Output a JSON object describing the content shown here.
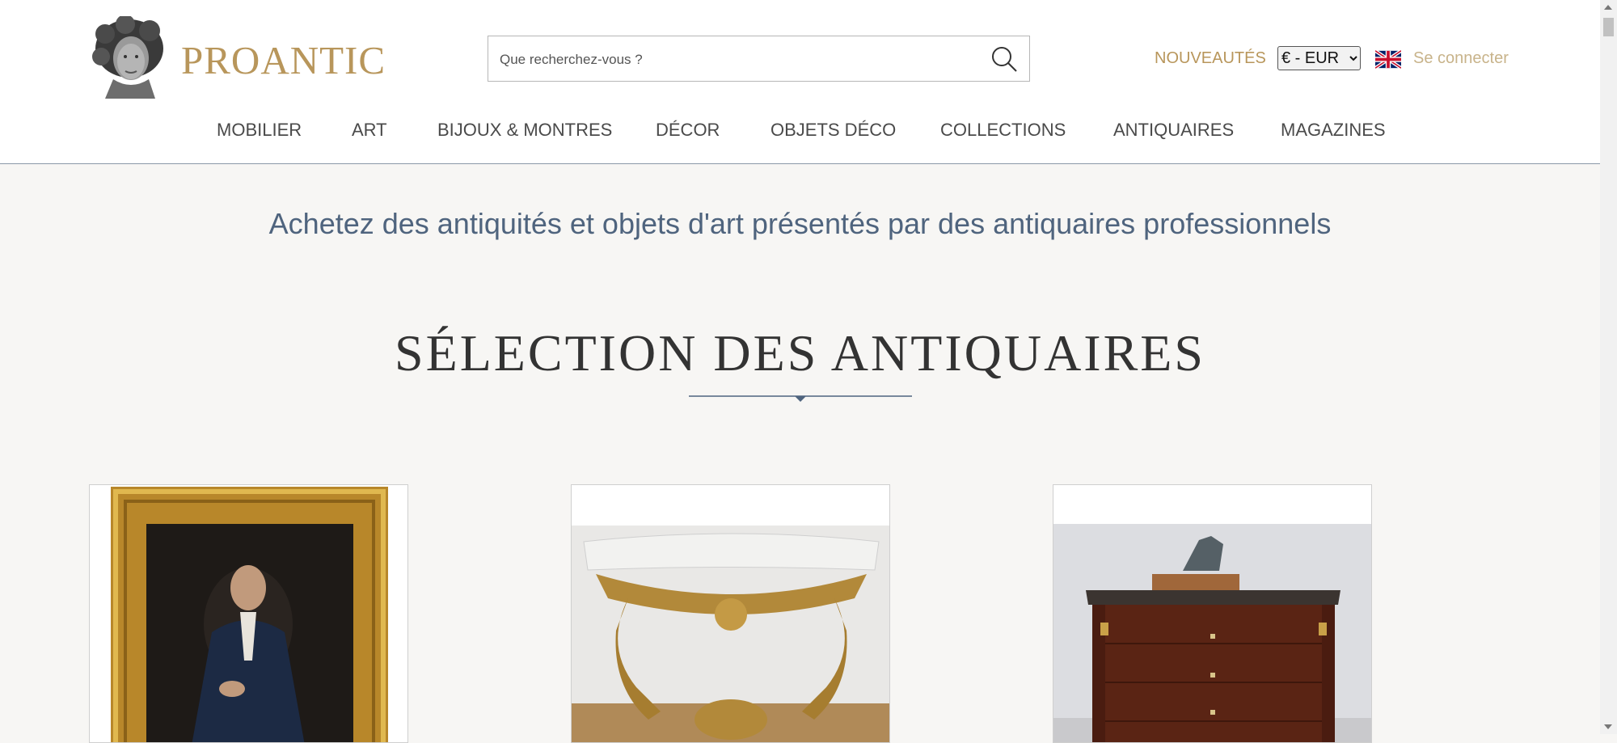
{
  "header": {
    "logo_text": "PROANTIC",
    "logo_icon": "classical-bust-logo",
    "search": {
      "placeholder": "Que recherchez-vous ?",
      "value": "",
      "icon": "search-icon"
    },
    "nouveautes_label": "NOUVEAUTÉS",
    "currency": {
      "selected": "€ - EUR",
      "options": [
        "€ - EUR"
      ]
    },
    "language_icon": "uk-flag-icon",
    "login_label": "Se connecter"
  },
  "nav": {
    "items": [
      {
        "label": "MOBILIER"
      },
      {
        "label": "ART"
      },
      {
        "label": "BIJOUX & MONTRES"
      },
      {
        "label": "DÉCOR"
      },
      {
        "label": "OBJETS DÉCO"
      },
      {
        "label": "COLLECTIONS"
      },
      {
        "label": "ANTIQUAIRES"
      },
      {
        "label": "MAGAZINES"
      }
    ]
  },
  "main": {
    "tagline": "Achetez des antiquités et objets d'art présentés par des antiquaires professionnels",
    "section_title": "SÉLECTION DES ANTIQUAIRES",
    "cards": [
      {
        "image": "gilt-framed-portrait-painting"
      },
      {
        "image": "gilt-console-marble-top"
      },
      {
        "image": "mahogany-commode-with-deer-bronze"
      }
    ]
  },
  "colors": {
    "brand_gold": "#b8965b",
    "login_gold": "#c8b38a",
    "tagline_blue": "#4f647e",
    "page_bg": "#f7f6f4"
  }
}
